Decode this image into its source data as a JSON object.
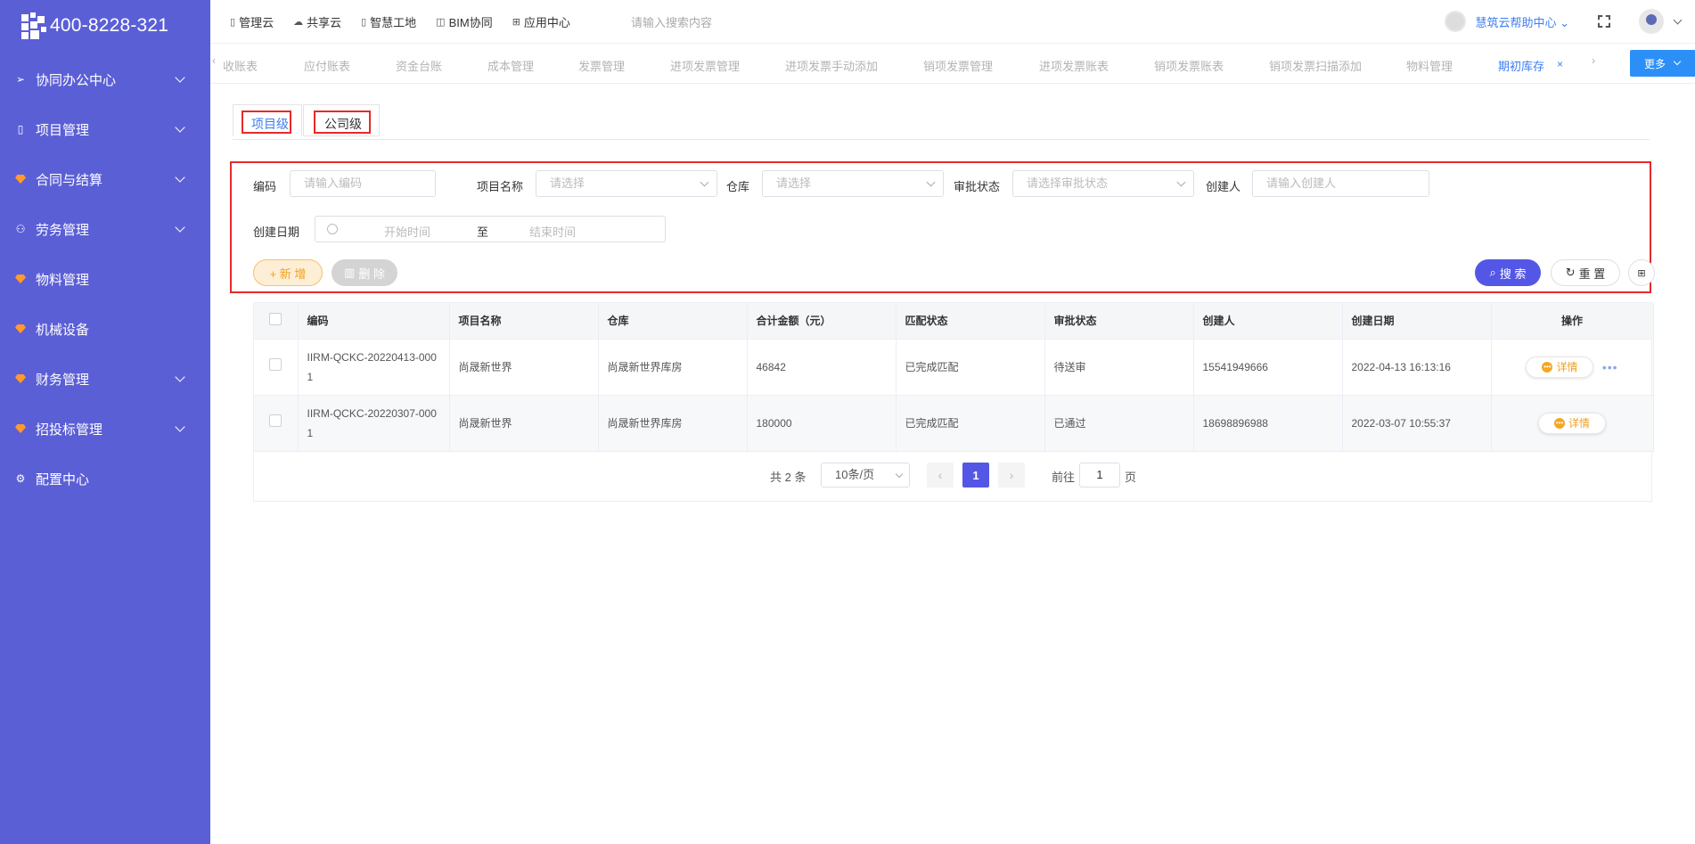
{
  "sidebar": {
    "phone": "400-8228-321",
    "items": [
      {
        "label": "协同办公中心",
        "icon": "send-icon",
        "has_arrow": true
      },
      {
        "label": "项目管理",
        "icon": "book-icon",
        "has_arrow": true
      },
      {
        "label": "合同与结算",
        "icon": "gem-icon",
        "has_arrow": true
      },
      {
        "label": "劳务管理",
        "icon": "user-icon",
        "has_arrow": true
      },
      {
        "label": "物料管理",
        "icon": "gem-icon",
        "has_arrow": false
      },
      {
        "label": "机械设备",
        "icon": "gem-icon",
        "has_arrow": false
      },
      {
        "label": "财务管理",
        "icon": "gem-icon",
        "has_arrow": true
      },
      {
        "label": "招投标管理",
        "icon": "gem-icon",
        "has_arrow": true
      },
      {
        "label": "配置中心",
        "icon": "gear-icon",
        "has_arrow": false
      }
    ]
  },
  "topbar": {
    "links": [
      "管理云",
      "共享云",
      "智慧工地",
      "BIM协同",
      "应用中心"
    ],
    "search_placeholder": "请输入搜索内容",
    "help": "慧筑云帮助中心"
  },
  "tabs": {
    "items": [
      "收账表",
      "应付账表",
      "资金台账",
      "成本管理",
      "发票管理",
      "进项发票管理",
      "进项发票手动添加",
      "销项发票管理",
      "进项发票账表",
      "销项发票账表",
      "销项发票扫描添加",
      "物料管理",
      "期初库存"
    ],
    "active": "期初库存",
    "more": "更多"
  },
  "level_tabs": {
    "project": "项目级",
    "company": "公司级"
  },
  "filters": {
    "code": {
      "label": "编码",
      "placeholder": "请输入编码"
    },
    "project": {
      "label": "项目名称",
      "placeholder": "请选择"
    },
    "warehouse": {
      "label": "仓库",
      "placeholder": "请选择"
    },
    "approval": {
      "label": "审批状态",
      "placeholder": "请选择审批状态"
    },
    "creator": {
      "label": "创建人",
      "placeholder": "请输入创建人"
    },
    "date": {
      "label": "创建日期",
      "start": "开始时间",
      "sep": "至",
      "end": "结束时间"
    },
    "buttons": {
      "add": "+ 新 增",
      "delete": "删 除",
      "search": "搜 索",
      "reset": "重 置"
    }
  },
  "table": {
    "headers": [
      "编码",
      "项目名称",
      "仓库",
      "合计金额（元）",
      "匹配状态",
      "审批状态",
      "创建人",
      "创建日期",
      "操作"
    ],
    "rows": [
      {
        "code": "IIRM-QCKC-20220413-0001",
        "project": "尚晟新世界",
        "warehouse": "尚晟新世界库房",
        "amount": "46842",
        "match": "已完成匹配",
        "approval": "待送审",
        "creator": "15541949666",
        "date": "2022-04-13 16:13:16",
        "action": "详情"
      },
      {
        "code": "IIRM-QCKC-20220307-0001",
        "project": "尚晟新世界",
        "warehouse": "尚晟新世界库房",
        "amount": "180000",
        "match": "已完成匹配",
        "approval": "已通过",
        "creator": "18698896988",
        "date": "2022-03-07 10:55:37",
        "action": "详情"
      }
    ]
  },
  "pagination": {
    "total": "共 2 条",
    "page_size": "10条/页",
    "current": "1",
    "goto": "前往",
    "goto_value": "1",
    "page_suffix": "页"
  },
  "colors": {
    "sidebar": "#5b5fd6",
    "primary": "#5457e6",
    "accent": "#f0a020",
    "highlight": "#e52a2a"
  }
}
